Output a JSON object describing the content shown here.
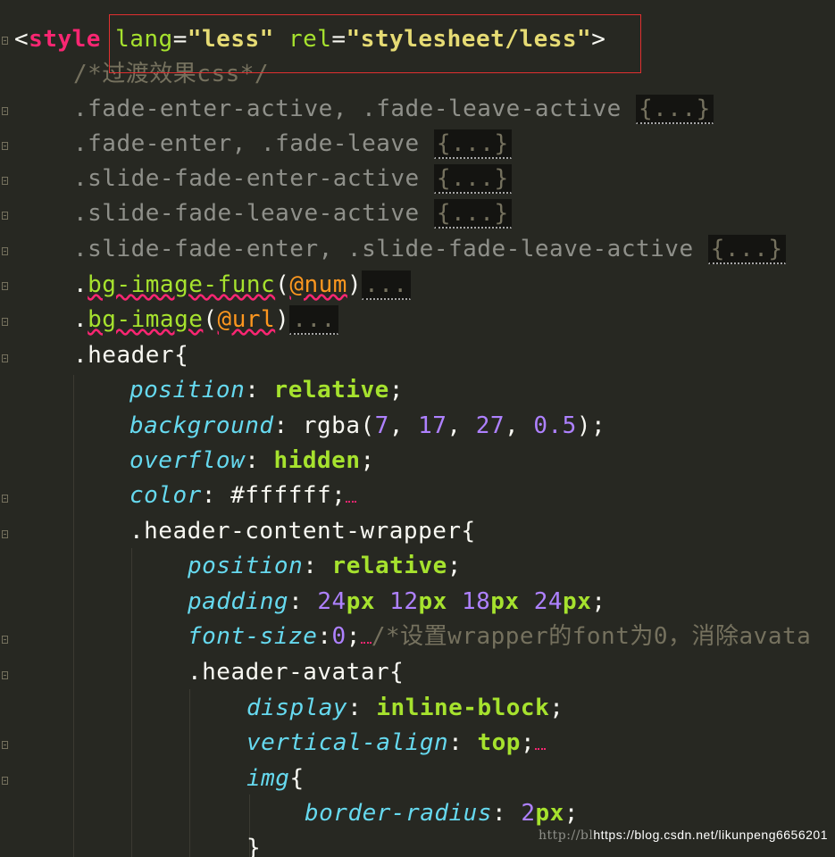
{
  "editor": {
    "watermark_ghost": "http://bl",
    "watermark": "https://blog.csdn.net/likunpeng6656201"
  },
  "code": {
    "l1": {
      "open": "<",
      "tag": "style",
      "attr1": "lang",
      "eq1": "=",
      "val1": "\"less\"",
      "attr2": "rel",
      "eq2": "=",
      "val2": "\"stylesheet/less\"",
      "close": ">"
    },
    "l2": {
      "comment": "/*过渡效果css*/"
    },
    "l3": {
      "selector": ".fade-enter-active, .fade-leave-active",
      "folded": "{...}"
    },
    "l4": {
      "selector": ".fade-enter, .fade-leave",
      "folded": "{...}"
    },
    "l5": {
      "selector": ".slide-fade-enter-active",
      "folded": "{...}"
    },
    "l6": {
      "selector": ".slide-fade-leave-active",
      "folded": "{...}"
    },
    "l7": {
      "selector": ".slide-fade-enter, .slide-fade-leave-active",
      "folded": "{...}"
    },
    "l8": {
      "dot": ".",
      "name": "bg-image-func",
      "open": "(",
      "arg": "@num",
      "close": ")",
      "folded": "..."
    },
    "l9": {
      "dot": ".",
      "name": "bg-image",
      "open": "(",
      "arg": "@url",
      "close": ")",
      "folded": "..."
    },
    "l10": {
      "selector": ".header",
      "brace": "{"
    },
    "l11": {
      "prop": "position",
      "colon": ": ",
      "val": "relative",
      "semi": ";"
    },
    "l12": {
      "prop": "background",
      "colon": ": ",
      "fn": "rgba(",
      "n1": "7",
      "c1": ", ",
      "n2": "17",
      "c2": ", ",
      "n3": "27",
      "c3": ", ",
      "n4": "0.5",
      "end": ");"
    },
    "l13": {
      "prop": "overflow",
      "colon": ": ",
      "val": "hidden",
      "semi": ";"
    },
    "l14": {
      "prop": "color",
      "colon": ": ",
      "val": "#ffffff",
      "semi": ";"
    },
    "l15": {
      "selector": ".header-content-wrapper",
      "brace": "{"
    },
    "l16": {
      "prop": "position",
      "colon": ": ",
      "val": "relative",
      "semi": ";"
    },
    "l17": {
      "prop": "padding",
      "colon": ": ",
      "n1": "24",
      "u1": "px",
      "n2": "12",
      "u2": "px",
      "n3": "18",
      "u3": "px",
      "n4": "24",
      "u4": "px",
      "semi": ";"
    },
    "l18": {
      "prop": "font-size",
      "colon": ":",
      "n1": "0",
      "semi": ";",
      "comment": "/*设置wrapper的font为0，消除avata"
    },
    "l19": {
      "selector": ".header-avatar",
      "brace": "{"
    },
    "l20": {
      "prop": "display",
      "colon": ": ",
      "val": "inline-block",
      "semi": ";"
    },
    "l21": {
      "prop": "vertical-align",
      "colon": ": ",
      "val": "top",
      "semi": ";"
    },
    "l22": {
      "selector": "img",
      "brace": "{"
    },
    "l23": {
      "prop": "border-radius",
      "colon": ": ",
      "n1": "2",
      "u1": "px",
      "semi": ";"
    },
    "l24": {
      "brace": "}"
    }
  }
}
